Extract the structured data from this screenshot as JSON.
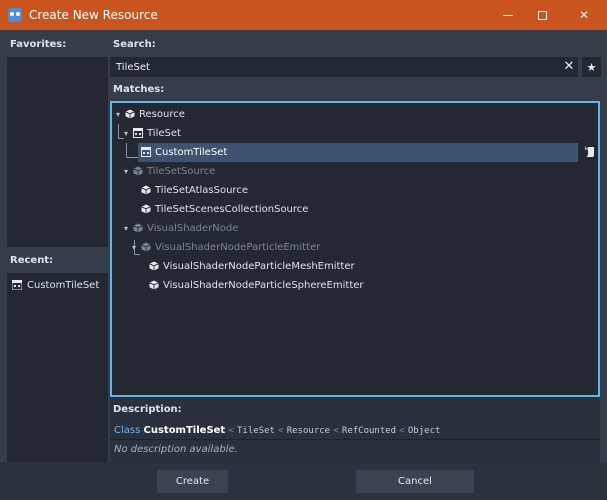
{
  "window": {
    "title": "Create New Resource",
    "minimize_label": "",
    "maximize_label": "",
    "close_label": "✕"
  },
  "favorites": {
    "label": "Favorites:"
  },
  "recent": {
    "label": "Recent:",
    "items": [
      {
        "label": "CustomTileSet",
        "icon": "tileset-icon"
      }
    ]
  },
  "search": {
    "label": "Search:",
    "value": "TileSet",
    "clear_glyph": "✕",
    "favorite_glyph": "★"
  },
  "matches": {
    "label": "Matches:",
    "rows": [
      {
        "label": "Resource",
        "icon": "resource-icon",
        "expanded": true,
        "dim": false
      },
      {
        "label": "TileSet",
        "icon": "tileset-icon",
        "expanded": true,
        "dim": false
      },
      {
        "label": "CustomTileSet",
        "icon": "tileset-icon",
        "selected": true,
        "dim": false
      },
      {
        "label": "TileSetSource",
        "icon": "resource-icon",
        "expanded": true,
        "dim": true
      },
      {
        "label": "TileSetAtlasSource",
        "icon": "resource-icon",
        "dim": false
      },
      {
        "label": "TileSetScenesCollectionSource",
        "icon": "resource-icon",
        "dim": false
      },
      {
        "label": "VisualShaderNode",
        "icon": "resource-icon",
        "expanded": true,
        "dim": true
      },
      {
        "label": "VisualShaderNodeParticleEmitter",
        "icon": "resource-icon",
        "expanded": true,
        "dim": true
      },
      {
        "label": "VisualShaderNodeParticleMeshEmitter",
        "icon": "resource-icon",
        "dim": false
      },
      {
        "label": "VisualShaderNodeParticleSphereEmitter",
        "icon": "resource-icon",
        "dim": false
      }
    ]
  },
  "description": {
    "label": "Description:",
    "class_keyword": "Class",
    "class_name": "CustomTileSet",
    "inheritance": [
      "TileSet",
      "Resource",
      "RefCounted",
      "Object"
    ],
    "separator": "<",
    "body": "No description available."
  },
  "buttons": {
    "create": "Create",
    "cancel": "Cancel"
  },
  "colors": {
    "titlebar": "#c9541d",
    "accent": "#62b6e6",
    "selection": "#3d5470",
    "panel": "#232833",
    "background": "#363d4a"
  }
}
